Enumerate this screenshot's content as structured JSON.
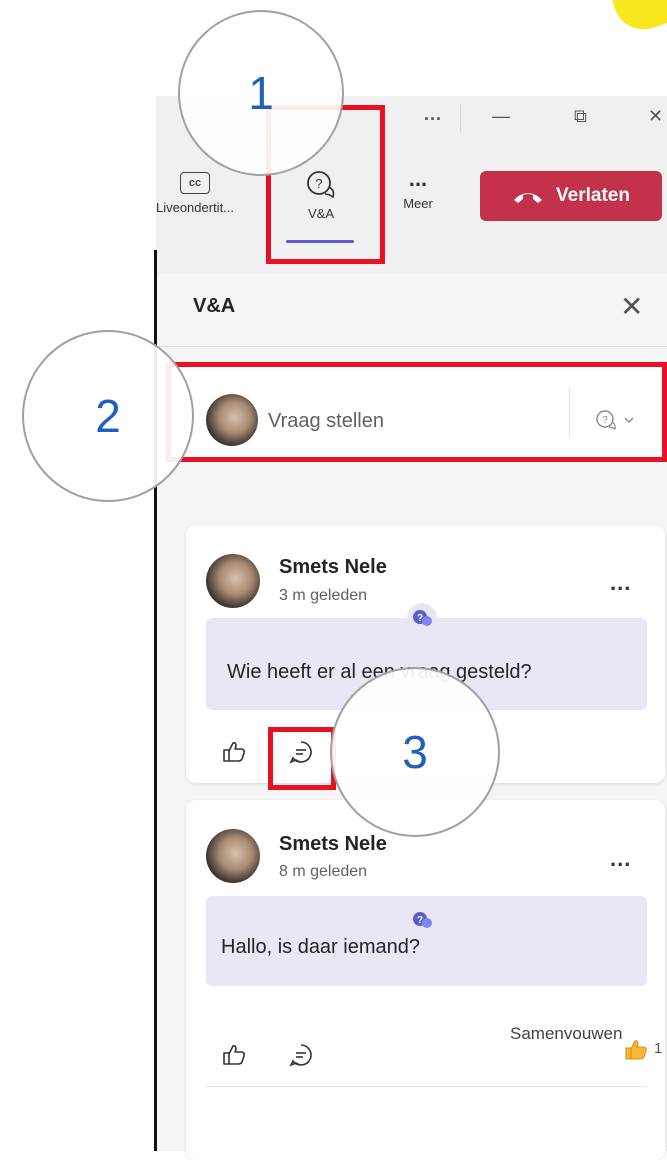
{
  "titlebar": {
    "more": "...",
    "minimize": "—",
    "restore": "⧉",
    "close": "✕"
  },
  "toolbar": {
    "captions_icon_text": "cc",
    "captions_label": "Liveondertit...",
    "qa_label": "V&A",
    "more_icon": "...",
    "more_label": "Meer",
    "leave_label": "Verlaten"
  },
  "panel": {
    "title": "V&A",
    "ask_placeholder": "Vraag stellen"
  },
  "questions": [
    {
      "author": "Smets Nele",
      "time": "3 m geleden",
      "text": "Wie heeft er al een vraag gesteld?"
    },
    {
      "author": "Smets Nele",
      "time": "8 m geleden",
      "text": "Hallo, is daar iemand?",
      "likes": "1"
    }
  ],
  "collapse_label": "Samenvouwen",
  "annotations": [
    "1",
    "2",
    "3"
  ],
  "colors": {
    "accent": "#5b5fc7",
    "leave": "#c4314b",
    "highlight": "#e81123",
    "annotation_number": "#1f5fbf"
  }
}
